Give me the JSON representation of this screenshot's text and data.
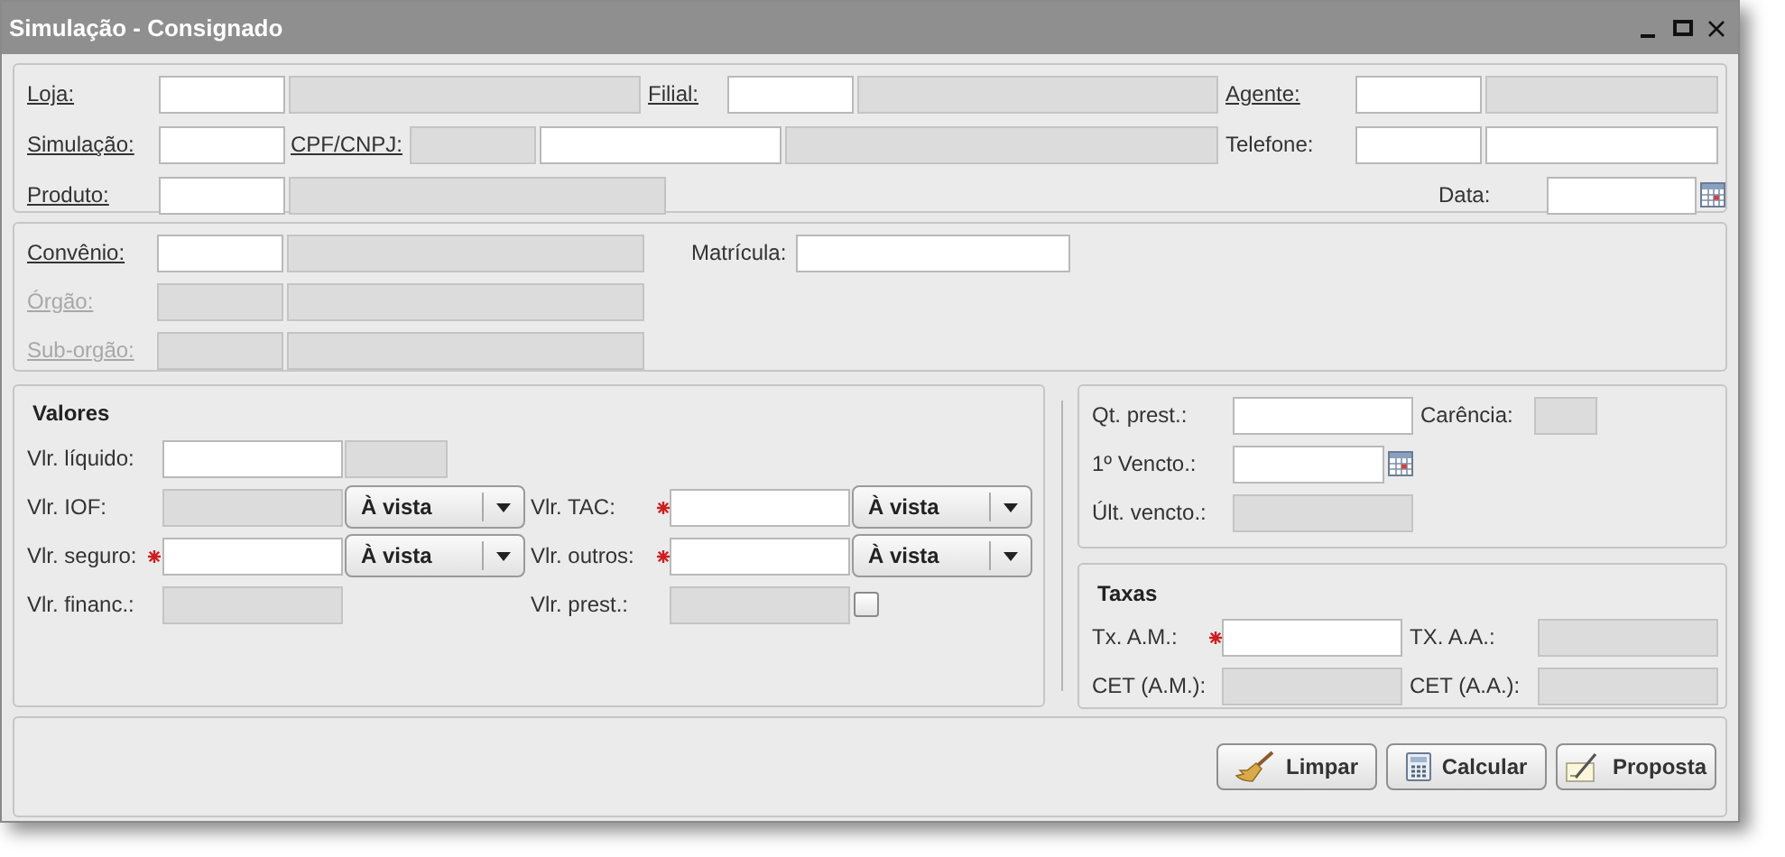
{
  "window": {
    "title": "Simulação - Consignado"
  },
  "header": {
    "loja": {
      "label": "Loja:",
      "underlined": true,
      "fields": [
        {
          "disabled": false
        },
        {
          "disabled": true
        }
      ]
    },
    "filial": {
      "label": "Filial:",
      "underlined": true,
      "fields": [
        {
          "disabled": false
        },
        {
          "disabled": true
        }
      ]
    },
    "agente": {
      "label": "Agente:",
      "underlined": true,
      "fields": [
        {
          "disabled": false
        },
        {
          "disabled": true
        }
      ]
    },
    "simulacao": {
      "label": "Simulação:",
      "underlined": true,
      "fields": [
        {
          "disabled": false
        }
      ]
    },
    "cpf_cnpj": {
      "label": "CPF/CNPJ:",
      "underlined": true,
      "fields": [
        {
          "disabled": true
        },
        {
          "disabled": false
        },
        {
          "disabled": true
        }
      ]
    },
    "telefone": {
      "label": "Telefone:",
      "underlined": false,
      "fields": [
        {
          "disabled": false
        },
        {
          "disabled": false
        }
      ]
    },
    "produto": {
      "label": "Produto:",
      "underlined": true,
      "fields": [
        {
          "disabled": false
        },
        {
          "disabled": true
        }
      ]
    },
    "data": {
      "label": "Data:",
      "underlined": false,
      "fields": [
        {
          "disabled": false
        }
      ]
    }
  },
  "convenio_panel": {
    "convenio": {
      "label": "Convênio:",
      "underlined": true,
      "disabled": false,
      "fields": [
        {
          "disabled": false
        },
        {
          "disabled": true
        }
      ]
    },
    "matricula": {
      "label": "Matrícula:",
      "underlined": false,
      "disabled": false,
      "fields": [
        {
          "disabled": false
        }
      ]
    },
    "orgao": {
      "label": "Órgão:",
      "underlined": true,
      "disabled": true,
      "fields": [
        {
          "disabled": true
        },
        {
          "disabled": true
        }
      ]
    },
    "sub_orgao": {
      "label": "Sub-orgão:",
      "underlined": true,
      "disabled": true,
      "fields": [
        {
          "disabled": true
        },
        {
          "disabled": true
        }
      ]
    }
  },
  "valores": {
    "title": "Valores",
    "vlr_liquido": {
      "label": "Vlr. líquido:",
      "required": false,
      "fields": [
        {
          "disabled": false
        },
        {
          "disabled": true
        }
      ]
    },
    "vlr_iof": {
      "label": "Vlr. IOF:",
      "required": false,
      "fields": [
        {
          "disabled": true
        }
      ],
      "select": {
        "value": "À vista"
      }
    },
    "vlr_tac": {
      "label": "Vlr. TAC:",
      "required": true,
      "fields": [
        {
          "disabled": false
        }
      ],
      "select": {
        "value": "À vista"
      }
    },
    "vlr_seguro": {
      "label": "Vlr. seguro:",
      "required": true,
      "fields": [
        {
          "disabled": false
        }
      ],
      "select": {
        "value": "À vista"
      }
    },
    "vlr_outros": {
      "label": "Vlr. outros:",
      "required": true,
      "fields": [
        {
          "disabled": false
        }
      ],
      "select": {
        "value": "À vista"
      }
    },
    "vlr_financ": {
      "label": "Vlr. financ.:",
      "required": false,
      "fields": [
        {
          "disabled": true
        }
      ]
    },
    "vlr_prest": {
      "label": "Vlr. prest.:",
      "required": false,
      "fields": [
        {
          "disabled": true
        }
      ],
      "checkbox": {
        "checked": false
      }
    }
  },
  "prazo": {
    "qt_prest": {
      "label": "Qt. prest.:",
      "fields": [
        {
          "disabled": false
        }
      ]
    },
    "carencia": {
      "label": "Carência:",
      "fields": [
        {
          "disabled": true
        }
      ]
    },
    "vencto_1": {
      "label": "1º Vencto.:",
      "fields": [
        {
          "disabled": false
        }
      ]
    },
    "ult_vencto": {
      "label": "Últ. vencto.:",
      "fields": [
        {
          "disabled": true
        }
      ]
    }
  },
  "taxas": {
    "title": "Taxas",
    "tx_am": {
      "label": "Tx. A.M.:",
      "required": true,
      "fields": [
        {
          "disabled": false
        }
      ]
    },
    "tx_aa": {
      "label": "TX. A.A.:",
      "required": false,
      "fields": [
        {
          "disabled": true
        }
      ]
    },
    "cet_am": {
      "label": "CET (A.M.):",
      "required": false,
      "fields": [
        {
          "disabled": true
        }
      ]
    },
    "cet_aa": {
      "label": "CET (A.A.):",
      "required": false,
      "fields": [
        {
          "disabled": true
        }
      ]
    }
  },
  "buttons": [
    {
      "label": "Limpar",
      "kind": "clear"
    },
    {
      "label": "Calcular",
      "kind": "calculate"
    },
    {
      "label": "Proposta",
      "kind": "proposal"
    }
  ]
}
